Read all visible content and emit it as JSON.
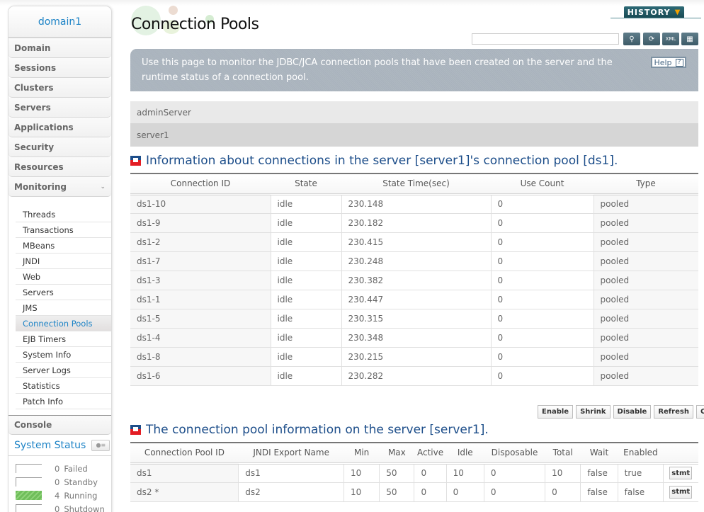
{
  "sidebar": {
    "domain": "domain1",
    "menu": [
      "Domain",
      "Sessions",
      "Clusters",
      "Servers",
      "Applications",
      "Security",
      "Resources"
    ],
    "monitoring": {
      "label": "Monitoring",
      "chevron": "chevron-down-icon"
    },
    "monitoring_items": [
      "Threads",
      "Transactions",
      "MBeans",
      "JNDI",
      "Web",
      "Servers",
      "JMS",
      "Connection Pools",
      "EJB Timers",
      "System Info",
      "Server Logs",
      "Statistics",
      "Patch Info"
    ],
    "active_item": "Connection Pools",
    "console": "Console",
    "system_status": {
      "title": "System Status",
      "rows": [
        {
          "count": "0",
          "label": "Failed",
          "fill": 0
        },
        {
          "count": "0",
          "label": "Standby",
          "fill": 0
        },
        {
          "count": "4",
          "label": "Running",
          "fill": 1
        },
        {
          "count": "0",
          "label": "Shutdown",
          "fill": 0
        }
      ]
    }
  },
  "header": {
    "title": "Connection Pools",
    "history_label": "HISTORY",
    "search_value": "",
    "tools": [
      "search-icon",
      "refresh-icon",
      "xml-export-icon",
      "report-icon"
    ]
  },
  "info": {
    "text": "Use this page to monitor the JDBC/JCA connection pools that have been created on the server and the runtime status of a connection pool.",
    "help_label": "Help",
    "help_glyph": "?"
  },
  "servers": [
    "adminServer",
    "server1"
  ],
  "connections_section": {
    "title": "Information about connections in the server [server1]'s connection pool [ds1].",
    "columns": [
      "Connection ID",
      "State",
      "State Time(sec)",
      "Use Count",
      "Type"
    ],
    "rows": [
      [
        "ds1-10",
        "idle",
        "230.148",
        "0",
        "pooled"
      ],
      [
        "ds1-9",
        "idle",
        "230.182",
        "0",
        "pooled"
      ],
      [
        "ds1-2",
        "idle",
        "230.415",
        "0",
        "pooled"
      ],
      [
        "ds1-7",
        "idle",
        "230.248",
        "0",
        "pooled"
      ],
      [
        "ds1-3",
        "idle",
        "230.382",
        "0",
        "pooled"
      ],
      [
        "ds1-1",
        "idle",
        "230.447",
        "0",
        "pooled"
      ],
      [
        "ds1-5",
        "idle",
        "230.315",
        "0",
        "pooled"
      ],
      [
        "ds1-4",
        "idle",
        "230.348",
        "0",
        "pooled"
      ],
      [
        "ds1-8",
        "idle",
        "230.215",
        "0",
        "pooled"
      ],
      [
        "ds1-6",
        "idle",
        "230.282",
        "0",
        "pooled"
      ]
    ]
  },
  "actions": [
    "Enable",
    "Shrink",
    "Disable",
    "Refresh",
    "Create"
  ],
  "pools_section": {
    "title": "The connection pool information on the server [server1].",
    "columns": [
      "Connection Pool ID",
      "JNDI Export Name",
      "Min",
      "Max",
      "Active",
      "Idle",
      "Disposable",
      "Total",
      "Wait",
      "Enabled",
      ""
    ],
    "rows": [
      [
        "ds1",
        "ds1",
        "10",
        "50",
        "0",
        "10",
        "0",
        "10",
        "false",
        "true"
      ],
      [
        "ds2 *",
        "ds2",
        "10",
        "50",
        "0",
        "0",
        "0",
        "0",
        "false",
        "false"
      ]
    ],
    "row_button": "stmt"
  }
}
